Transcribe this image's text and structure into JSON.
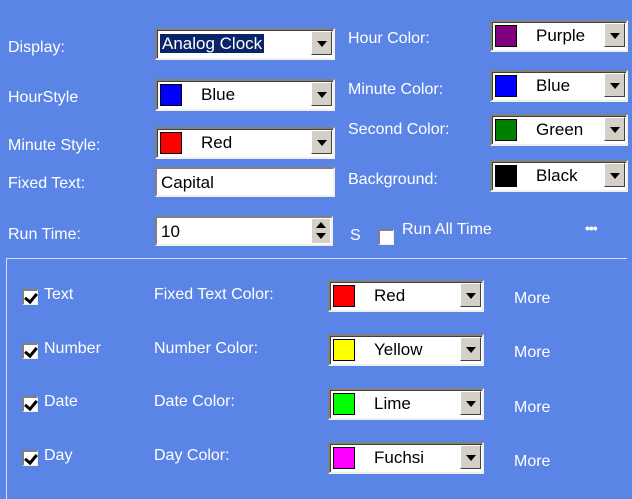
{
  "left": {
    "display_label": "Display:",
    "display_value": "Analog Clock",
    "hourstyle_label": "HourStyle",
    "hourstyle_value": "Blue",
    "minutestyle_label": "Minute Style:",
    "minutestyle_value": "Red",
    "fixedtext_label": "Fixed Text:",
    "fixedtext_value": "Capital",
    "runtime_label": "Run Time:",
    "runtime_value": "10"
  },
  "right": {
    "hourcolor_label": "Hour Color:",
    "hourcolor_value": "Purple",
    "minutecolor_label": "Minute Color:",
    "minutecolor_value": "Blue",
    "secondcolor_label": "Second Color:",
    "secondcolor_value": "Green",
    "background_label": "Background:",
    "background_value": "Black",
    "seconds_unit": "S",
    "runalltime_label": "Run All Time",
    "more_dots": "•••"
  },
  "rows": [
    {
      "check_label": "Text",
      "color_label": "Fixed Text Color:",
      "color_value": "Red",
      "more": "More"
    },
    {
      "check_label": "Number",
      "color_label": "Number Color:",
      "color_value": "Yellow",
      "more": "More"
    },
    {
      "check_label": "Date",
      "color_label": "Date Color:",
      "color_value": "Lime",
      "more": "More"
    },
    {
      "check_label": "Day",
      "color_label": "Day Color:",
      "color_value": "Fuchsi",
      "more": "More"
    }
  ],
  "colors": {
    "background": "#5a84e6",
    "purple": "#800080",
    "blue": "#0000ff",
    "red": "#ff0000",
    "green": "#008000",
    "black": "#000000",
    "yellow": "#ffff00",
    "lime": "#00ff00",
    "fuchsia": "#ff00ff"
  }
}
